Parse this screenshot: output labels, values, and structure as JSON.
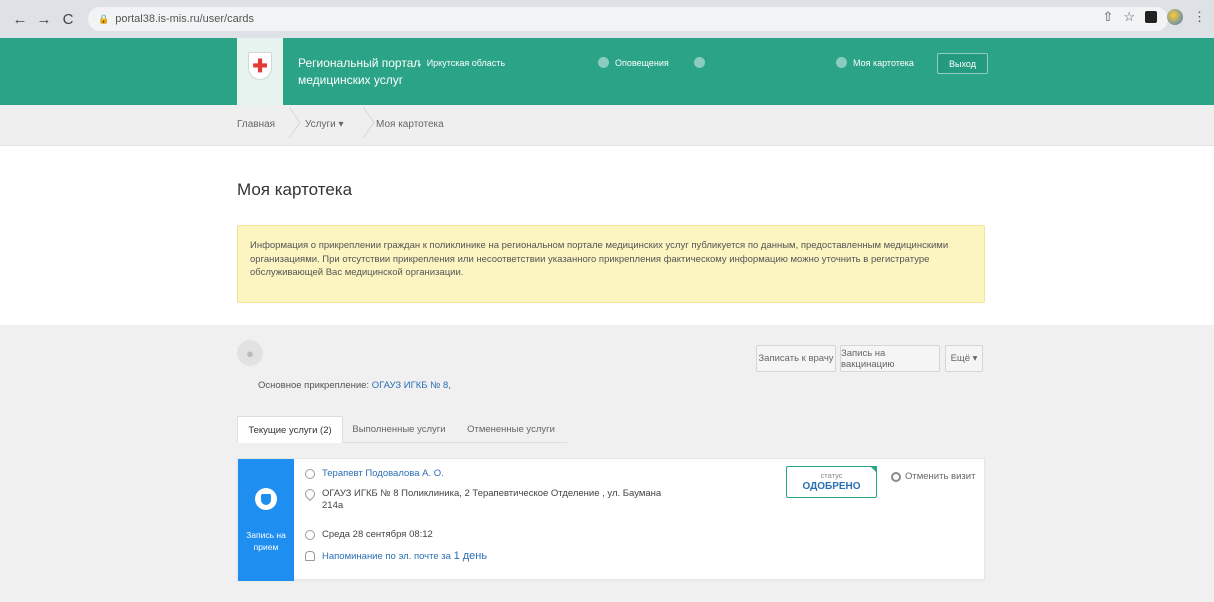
{
  "browser": {
    "url": "portal38.is-mis.ru/user/cards",
    "back_icon": "←",
    "forward_icon": "→",
    "reload_icon": "C",
    "share_icon": "⇧",
    "star_icon": "☆",
    "menu_icon": "⋮"
  },
  "header": {
    "title_line1": "Региональный портал",
    "title_line2": "медицинских услуг",
    "region": "Иркутская область",
    "notifications": "Оповещения",
    "my_cards": "Моя картотека",
    "logout": "Выход",
    "accent_color": "#2aa387"
  },
  "breadcrumb": {
    "home": "Главная",
    "services": "Услуги ▾",
    "current": "Моя картотека"
  },
  "page": {
    "title": "Моя картотека",
    "info_text": "Информация о прикреплении граждан к поликлинике на региональном портале медицинских услуг публикуется по данным, предоставленным медицинскими организациями. При отсутствии прикрепления или несоответствии указанного прикрепления фактическому информацию можно уточнить в регистратуре обслуживающей Вас медицинской организации."
  },
  "patient": {
    "attachment_label": "Основное прикрепление:",
    "attachment_org": "ОГАУЗ ИГКБ № 8,"
  },
  "actions": {
    "book_doctor": "Записать к врачу",
    "book_vaccination": "Запись на вакцинацию",
    "more": "Ещё ▾"
  },
  "tabs": {
    "current": "Текущие услуги (2)",
    "completed": "Выполненные услуги",
    "cancelled": "Отмененные услуги"
  },
  "appointment": {
    "type_label": "Запись на прием",
    "doctor": "Терапевт Подовалова А. О.",
    "address_line1": "ОГАУЗ ИГКБ № 8 Поликлиника, 2 Терапевтическое Отделение , ул. Баумана",
    "address_line2": "214а",
    "datetime": "Среда 28 сентября 08:12",
    "reminder_text": "Напоминание по эл. почте за",
    "reminder_value": "1 день",
    "status_label": "статус",
    "status_value": "ОДОБРЕНО",
    "cancel": "Отменить визит",
    "side_color": "#1f8ef1"
  }
}
